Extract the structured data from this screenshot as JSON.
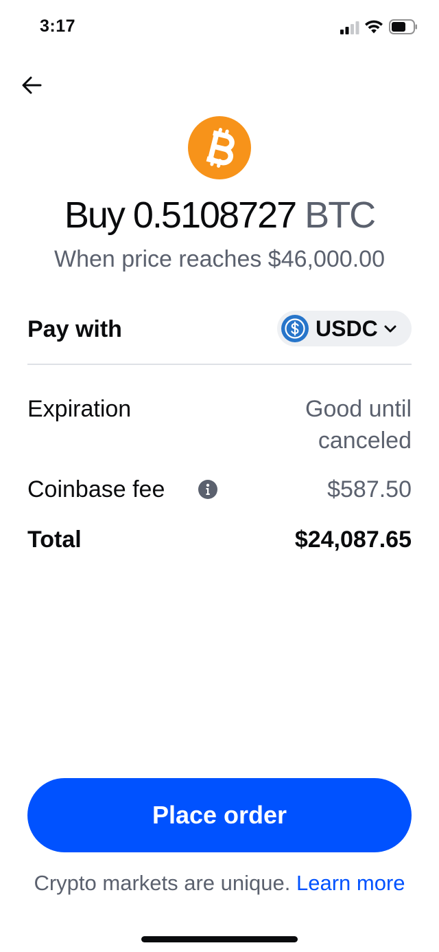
{
  "status_bar": {
    "time": "3:17"
  },
  "order": {
    "coin_icon": "bitcoin-icon",
    "brand_color": "#f7931a",
    "headline_prefix": "Buy",
    "amount": "0.5108727",
    "unit": "BTC",
    "trigger_text": "When price reaches $46,000.00"
  },
  "details": {
    "pay_with_label": "Pay with",
    "pay_asset": "USDC",
    "pay_asset_icon": "usdc-icon",
    "expiration_label": "Expiration",
    "expiration_value": "Good until canceled",
    "fee_label": "Coinbase fee",
    "fee_value": "$587.50",
    "total_label": "Total",
    "total_value": "$24,087.65"
  },
  "actions": {
    "place_order_label": "Place order",
    "accent_color": "#0052ff"
  },
  "footer": {
    "disclaimer": "Crypto markets are unique.",
    "learn_more": "Learn more"
  }
}
